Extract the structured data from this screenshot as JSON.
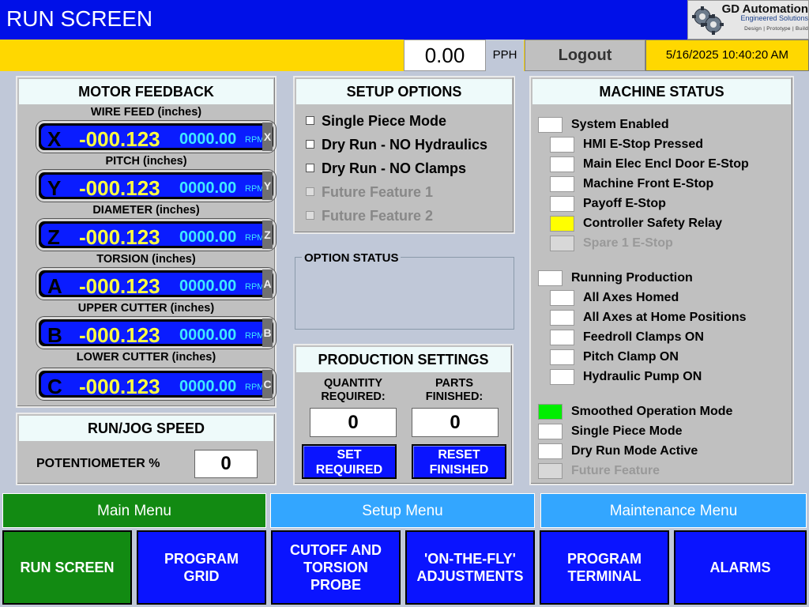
{
  "header": {
    "title": "RUN SCREEN",
    "logo": {
      "name": "GD Automation",
      "subtitle": "Engineered Solutions",
      "tagline": "Design | Prototype | Build"
    }
  },
  "status_bar": {
    "pph_value": "0.00",
    "pph_label": "PPH",
    "logout_label": "Logout",
    "datetime": "5/16/2025 10:40:20 AM"
  },
  "motor_feedback": {
    "title": "MOTOR FEEDBACK",
    "axes": [
      {
        "label": "WIRE FEED (inches)",
        "letter": "X",
        "position": "-000.123",
        "rpm": "0000.00",
        "unit": "RPM",
        "tab": "X"
      },
      {
        "label": "PITCH (inches)",
        "letter": "Y",
        "position": "-000.123",
        "rpm": "0000.00",
        "unit": "RPM",
        "tab": "Y"
      },
      {
        "label": "DIAMETER (inches)",
        "letter": "Z",
        "position": "-000.123",
        "rpm": "0000.00",
        "unit": "RPM",
        "tab": "Z"
      },
      {
        "label": "TORSION (inches)",
        "letter": "A",
        "position": "-000.123",
        "rpm": "0000.00",
        "unit": "RPM",
        "tab": "A"
      },
      {
        "label": "UPPER CUTTER (inches)",
        "letter": "B",
        "position": "-000.123",
        "rpm": "0000.00",
        "unit": "RPM",
        "tab": "B"
      },
      {
        "label": "LOWER CUTTER (inches)",
        "letter": "C",
        "position": "-000.123",
        "rpm": "0000.00",
        "unit": "RPM",
        "tab": "C"
      }
    ]
  },
  "run_jog": {
    "title": "RUN/JOG SPEED",
    "label": "POTENTIOMETER %",
    "value": "0"
  },
  "setup_options": {
    "title": "SETUP OPTIONS",
    "options": [
      {
        "label": "Single Piece Mode",
        "checked": false,
        "enabled": true
      },
      {
        "label": "Dry Run - NO Hydraulics",
        "checked": false,
        "enabled": true
      },
      {
        "label": "Dry Run - NO Clamps",
        "checked": false,
        "enabled": true
      },
      {
        "label": "Future Feature 1",
        "checked": false,
        "enabled": false
      },
      {
        "label": "Future Feature 2",
        "checked": false,
        "enabled": false
      }
    ]
  },
  "option_status": {
    "title": "OPTION STATUS"
  },
  "production_settings": {
    "title": "PRODUCTION SETTINGS",
    "qty_label_1": "QUANTITY",
    "qty_label_2": "REQUIRED:",
    "parts_label_1": "PARTS",
    "parts_label_2": "FINISHED:",
    "qty_value": "0",
    "parts_value": "0",
    "set_btn_1": "SET",
    "set_btn_2": "REQUIRED",
    "reset_btn_1": "RESET",
    "reset_btn_2": "FINISHED"
  },
  "machine_status": {
    "title": "MACHINE STATUS",
    "colors": {
      "off": "#ffffff",
      "warning": "#ffff00",
      "on": "#00ee00",
      "disabled": "#d8d8d8"
    },
    "groups": [
      {
        "header": {
          "label": "System Enabled",
          "state": "off"
        },
        "items": [
          {
            "label": "HMI E-Stop Pressed",
            "state": "off"
          },
          {
            "label": "Main Elec Encl Door E-Stop",
            "state": "off"
          },
          {
            "label": "Machine Front E-Stop",
            "state": "off"
          },
          {
            "label": "Payoff E-Stop",
            "state": "off"
          },
          {
            "label": "Controller Safety Relay",
            "state": "warning"
          },
          {
            "label": "Spare 1 E-Stop",
            "state": "disabled"
          }
        ]
      },
      {
        "header": {
          "label": "Running Production",
          "state": "off"
        },
        "items": [
          {
            "label": "All Axes Homed",
            "state": "off"
          },
          {
            "label": "All Axes at Home Positions",
            "state": "off"
          },
          {
            "label": "Feedroll Clamps ON",
            "state": "off"
          },
          {
            "label": "Pitch Clamp ON",
            "state": "off"
          },
          {
            "label": "Hydraulic Pump ON",
            "state": "off"
          }
        ]
      },
      {
        "header": null,
        "items": [
          {
            "label": "Smoothed Operation Mode",
            "state": "on"
          },
          {
            "label": "Single Piece Mode",
            "state": "off"
          },
          {
            "label": "Dry Run Mode Active",
            "state": "off"
          },
          {
            "label": "Future Feature",
            "state": "disabled"
          }
        ]
      }
    ]
  },
  "menus": {
    "tabs": [
      {
        "label": "Main Menu",
        "bg": "#128a12",
        "active": true
      },
      {
        "label": "Setup Menu",
        "bg": "#33a6ff",
        "active": false
      },
      {
        "label": "Maintenance Menu",
        "bg": "#33a6ff",
        "active": false
      }
    ],
    "buttons": [
      {
        "lines": [
          "RUN SCREEN"
        ],
        "bg": "#128a12"
      },
      {
        "lines": [
          "PROGRAM",
          "GRID"
        ],
        "bg": "#0a14ff"
      },
      {
        "lines": [
          "CUTOFF AND",
          "TORSION",
          "PROBE"
        ],
        "bg": "#0a14ff"
      },
      {
        "lines": [
          "'ON-THE-FLY'",
          "ADJUSTMENTS"
        ],
        "bg": "#0a14ff"
      },
      {
        "lines": [
          "PROGRAM",
          "TERMINAL"
        ],
        "bg": "#0a14ff"
      },
      {
        "lines": [
          "ALARMS"
        ],
        "bg": "#0a14ff"
      }
    ]
  }
}
